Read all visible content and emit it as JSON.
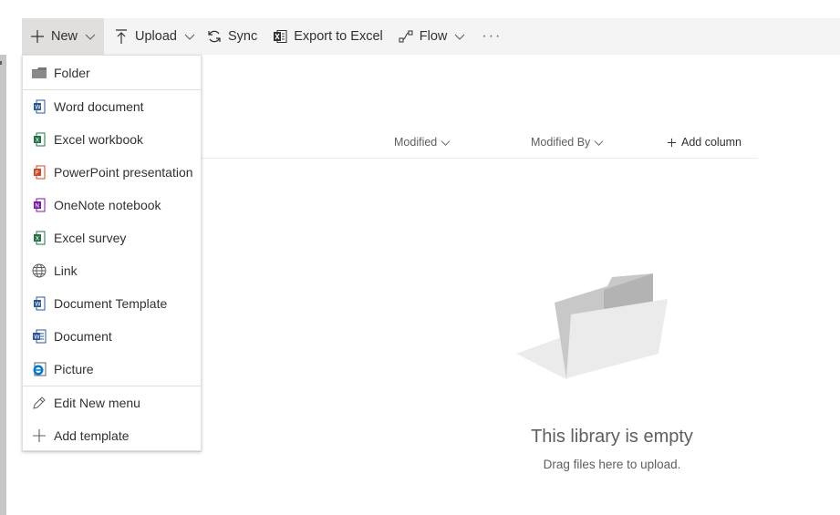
{
  "toolbar": {
    "new_label": "New",
    "upload_label": "Upload",
    "sync_label": "Sync",
    "export_label": "Export to Excel",
    "flow_label": "Flow",
    "more_label": "···"
  },
  "columns": {
    "modified": "Modified",
    "modified_by": "Modified By",
    "add_column": "Add column"
  },
  "new_menu": {
    "items": [
      {
        "label": "Folder",
        "icon": "folder-icon"
      },
      {
        "label": "Word document",
        "icon": "word-icon"
      },
      {
        "label": "Excel workbook",
        "icon": "excel-icon"
      },
      {
        "label": "PowerPoint presentation",
        "icon": "powerpoint-icon"
      },
      {
        "label": "OneNote notebook",
        "icon": "onenote-icon"
      },
      {
        "label": "Excel survey",
        "icon": "excel-icon"
      },
      {
        "label": "Link",
        "icon": "globe-icon"
      },
      {
        "label": "Document Template",
        "icon": "word-icon"
      },
      {
        "label": "Document",
        "icon": "word-doc-icon"
      },
      {
        "label": "Picture",
        "icon": "picture-icon"
      }
    ],
    "edit_label": "Edit New menu",
    "add_template_label": "Add template"
  },
  "empty_state": {
    "title": "This library is empty",
    "subtitle": "Drag files here to upload."
  },
  "colors": {
    "command_bar_bg": "#f4f4f4",
    "active_bg": "#e1dfdd",
    "word": "#2b579a",
    "excel": "#217346",
    "powerpoint": "#d24726",
    "onenote": "#7719aa",
    "picture": "#0078d4"
  }
}
